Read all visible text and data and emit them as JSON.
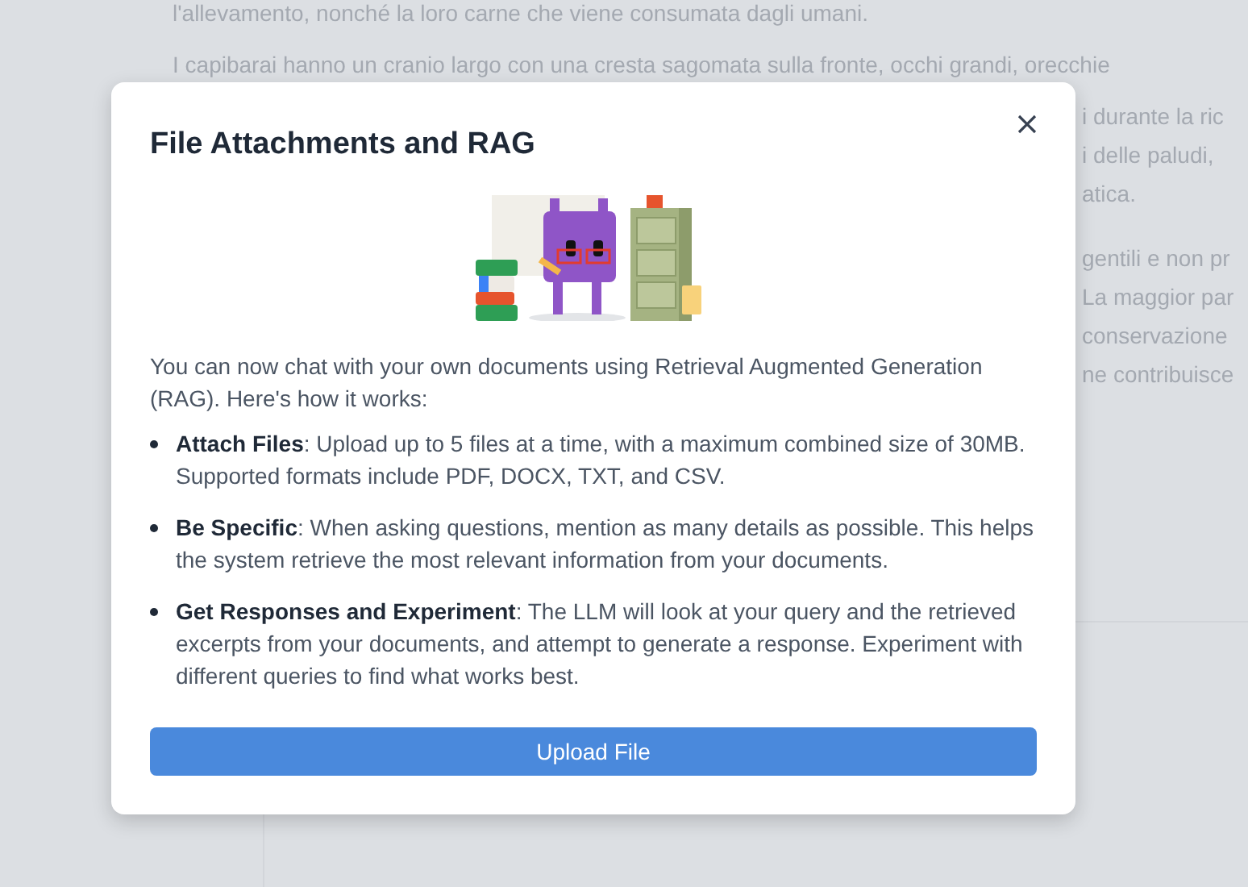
{
  "background": {
    "lines": [
      "l'allevamento, nonché la loro carne che viene consumata dagli umani.",
      "I capibarai hanno un cranio largo con una cresta sagomata sulla fronte, occhi grandi, orecchie"
    ],
    "fragments": [
      "i durante la ric",
      "i delle paludi,",
      "atica.",
      "gentili e non pr",
      "La maggior par",
      "conservazione",
      "ne contribuisce"
    ]
  },
  "dialog": {
    "title": "File Attachments and RAG",
    "intro": "You can now chat with your own documents using Retrieval Augmented Generation (RAG). Here's how it works:",
    "items": [
      "**Attach Files**: Upload up to 5 files at a time, with a maximum combined size of 30MB. Supported formats include PDF, DOCX, TXT, and CSV.",
      "**Be Specific**: When asking questions, mention as many details as possible. This helps the system retrieve the most relevant information from your documents.",
      "**Get Responses and Experiment**: The LLM will look at your query and the retrieved excerpts from your documents, and attempt to generate a response. Experiment with different queries to find what works best."
    ],
    "button": "Upload File"
  }
}
